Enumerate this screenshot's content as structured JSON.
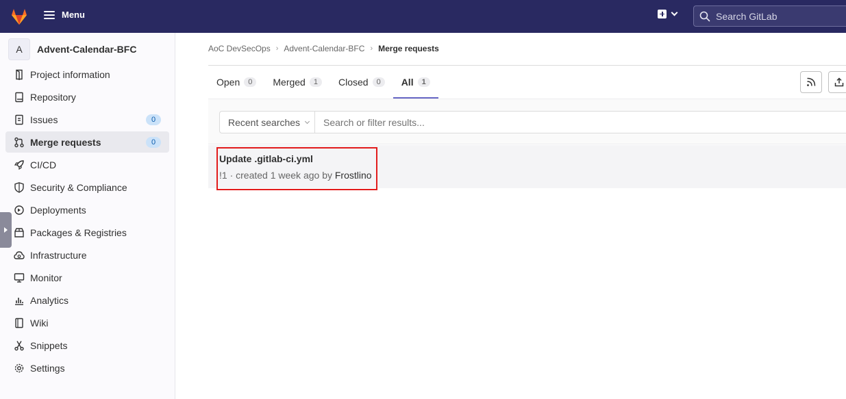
{
  "topbar": {
    "menu_label": "Menu",
    "search_placeholder": "Search GitLab"
  },
  "project": {
    "avatar_letter": "A",
    "name": "Advent-Calendar-BFC"
  },
  "sidebar": {
    "items": [
      {
        "label": "Project information",
        "icon": "info-icon"
      },
      {
        "label": "Repository",
        "icon": "book-icon"
      },
      {
        "label": "Issues",
        "icon": "issues-icon",
        "count": "0"
      },
      {
        "label": "Merge requests",
        "icon": "merge-request-icon",
        "count": "0",
        "active": true
      },
      {
        "label": "CI/CD",
        "icon": "rocket-icon"
      },
      {
        "label": "Security & Compliance",
        "icon": "shield-icon"
      },
      {
        "label": "Deployments",
        "icon": "deployments-icon"
      },
      {
        "label": "Packages & Registries",
        "icon": "package-icon"
      },
      {
        "label": "Infrastructure",
        "icon": "cloud-icon"
      },
      {
        "label": "Monitor",
        "icon": "monitor-icon"
      },
      {
        "label": "Analytics",
        "icon": "chart-icon"
      },
      {
        "label": "Wiki",
        "icon": "wiki-icon"
      },
      {
        "label": "Snippets",
        "icon": "scissors-icon"
      },
      {
        "label": "Settings",
        "icon": "gear-icon"
      }
    ]
  },
  "breadcrumb": {
    "group": "AoC DevSecOps",
    "project": "Advent-Calendar-BFC",
    "current": "Merge requests"
  },
  "tabs": [
    {
      "label": "Open",
      "count": "0"
    },
    {
      "label": "Merged",
      "count": "1"
    },
    {
      "label": "Closed",
      "count": "0"
    },
    {
      "label": "All",
      "count": "1",
      "active": true
    }
  ],
  "filter": {
    "recent_label": "Recent searches",
    "placeholder": "Search or filter results..."
  },
  "merge_requests": [
    {
      "title": "Update .gitlab-ci.yml",
      "meta_prefix": "!1 · created 1 week ago by ",
      "author": "Frostlino"
    }
  ],
  "colors": {
    "topbar": "#292961",
    "highlight": "#e21b1b",
    "active_tab": "#6666c4"
  }
}
